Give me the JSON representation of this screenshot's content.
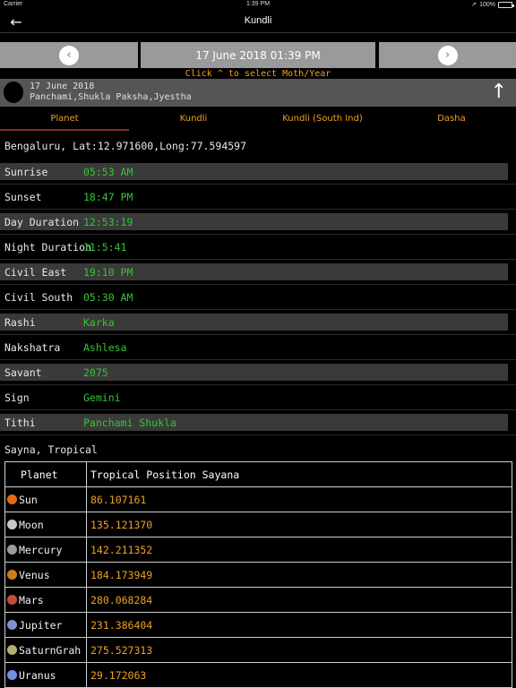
{
  "status_bar": {
    "carrier": "Carrier",
    "wifi_icon": "wifi-icon",
    "time": "1:39 PM",
    "location_icon": "location-arrow-icon",
    "battery": "100%"
  },
  "nav": {
    "title": "Kundli",
    "back_icon": "back-arrow-icon"
  },
  "date_selector": {
    "current": "17 June 2018 01:39 PM",
    "prev_icon": "chevron-left-icon",
    "next_icon": "chevron-right-icon",
    "hint": "Click ^ to select Moth/Year"
  },
  "info": {
    "date": "17 June 2018",
    "detail": "Panchami,Shukla Paksha,Jyestha",
    "moon_icon": "moon-phase-icon",
    "up_icon": "arrow-up-icon"
  },
  "tabs": [
    {
      "label": "Planet"
    },
    {
      "label": "Kundli"
    },
    {
      "label": "Kundli (South Ind)"
    },
    {
      "label": "Dasha"
    }
  ],
  "location": "Bengaluru, Lat:12.971600,Long:77.594597",
  "details": [
    {
      "label": "Sunrise",
      "value": "05:53 AM"
    },
    {
      "label": "Sunset",
      "value": "18:47 PM"
    },
    {
      "label": "Day Duration",
      "value": "12:53:19"
    },
    {
      "label": "Night Duration",
      "value": "11:5:41"
    },
    {
      "label": "Civil East",
      "value": "19:10 PM"
    },
    {
      "label": "Civil South",
      "value": "05:30 AM"
    },
    {
      "label": "Rashi",
      "value": "Karka"
    },
    {
      "label": "Nakshatra",
      "value": "Ashlesa"
    },
    {
      "label": "Savant",
      "value": "2075"
    },
    {
      "label": "Sign",
      "value": "Gemini"
    },
    {
      "label": "Tithi",
      "value": "Panchami Shukla"
    }
  ],
  "section_label": "Sayna, Tropical",
  "planet_table": {
    "headers": [
      "Planet",
      "Tropical Position Sayana"
    ],
    "rows": [
      {
        "name": "Sun",
        "value": "86.107161",
        "icon": "sun-icon",
        "color": "#e86a10"
      },
      {
        "name": "Moon",
        "value": "135.121370",
        "icon": "moon-icon",
        "color": "#c8c8c8"
      },
      {
        "name": "Mercury",
        "value": "142.211352",
        "icon": "mercury-icon",
        "color": "#9a9a9a"
      },
      {
        "name": "Venus",
        "value": "184.173949",
        "icon": "venus-icon",
        "color": "#d07a20"
      },
      {
        "name": "Mars",
        "value": "280.068284",
        "icon": "mars-icon",
        "color": "#c0503a"
      },
      {
        "name": "Jupiter",
        "value": "231.386404",
        "icon": "jupiter-icon",
        "color": "#8090d0"
      },
      {
        "name": "SaturnGrah",
        "value": "275.527313",
        "icon": "saturn-icon",
        "color": "#b0b070"
      },
      {
        "name": "Uranus",
        "value": "29.172063",
        "icon": "uranus-icon",
        "color": "#7090e0"
      }
    ]
  }
}
